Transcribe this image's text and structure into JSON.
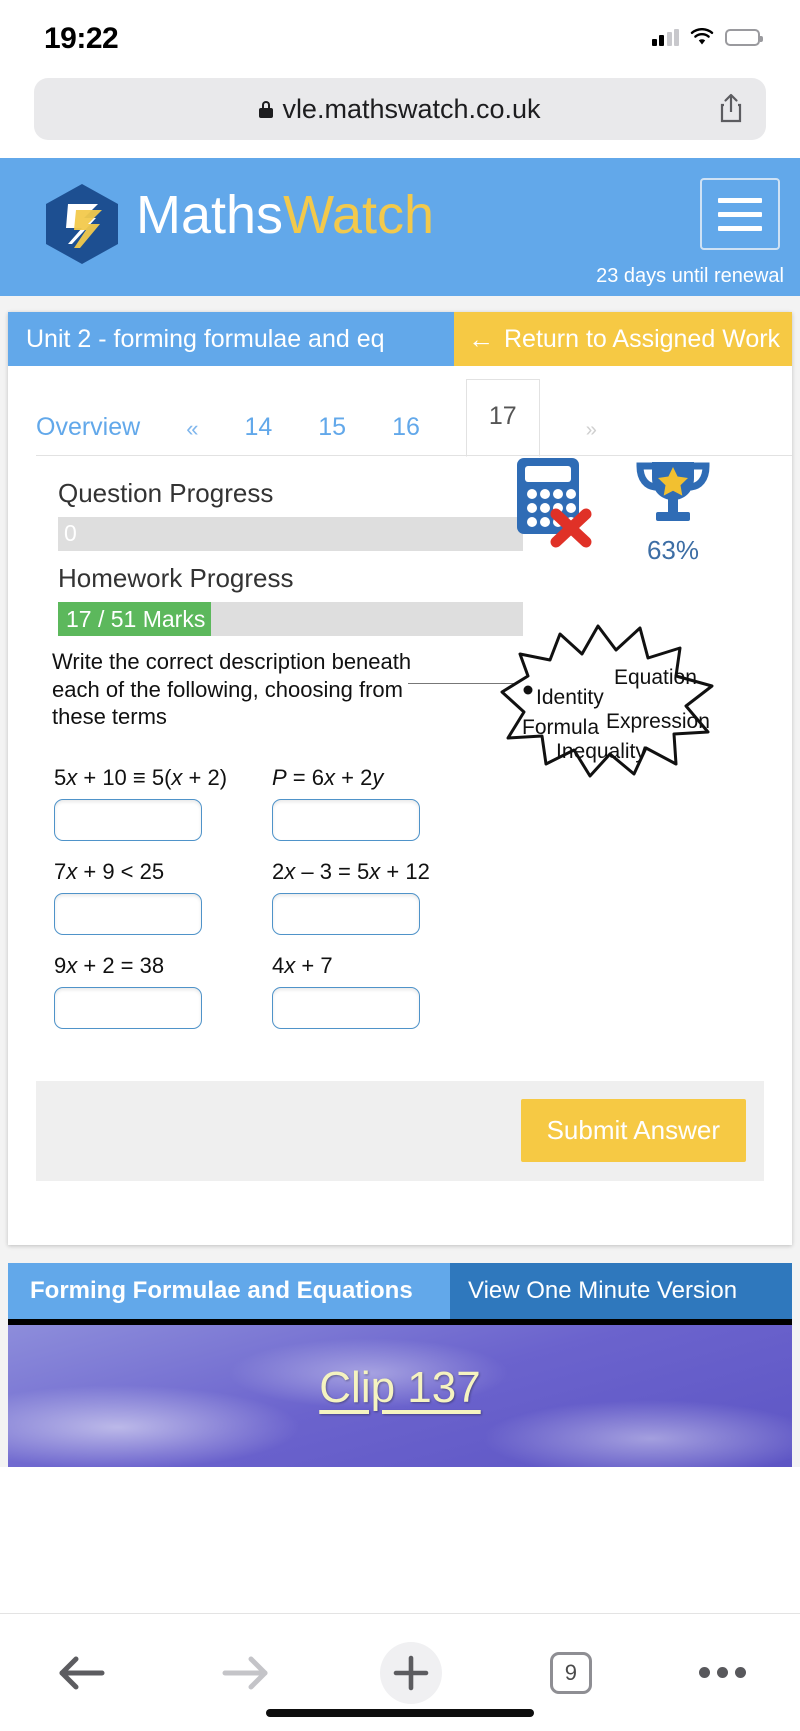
{
  "status_bar": {
    "time": "19:22",
    "signal_icon": "cellular-signal-icon",
    "wifi_icon": "wifi-icon",
    "battery_icon": "battery-icon"
  },
  "browser": {
    "url": "vle.mathswatch.co.uk",
    "lock_icon": "lock-icon",
    "share_icon": "share-icon",
    "back_icon": "arrow-left-icon",
    "forward_icon": "arrow-right-icon",
    "new_tab_icon": "plus-icon",
    "tab_count": "9",
    "more_icon": "ellipsis-icon"
  },
  "site_header": {
    "brand_first": "Maths",
    "brand_second": "Watch",
    "logo_icon": "mathswatch-hexagon-logo",
    "menu_icon": "hamburger-menu-icon",
    "renewal_notice": "23 days until renewal",
    "brand_bg": "#62a8ea",
    "brand_accent": "#f2c94c"
  },
  "panel": {
    "title": "Unit 2 - forming formulae and eq",
    "return_label": "Return to Assigned Work",
    "return_arrow": "←",
    "return_bg": "#f6c944"
  },
  "tabs": {
    "overview": "Overview",
    "prev": "«",
    "next": "»",
    "numbers": [
      "14",
      "15",
      "16",
      "17"
    ],
    "active": "17"
  },
  "progress": {
    "question_label": "Question Progress",
    "question_value": "0",
    "question_percent": 0,
    "homework_label": "Homework Progress",
    "homework_value": "17 / 51 Marks",
    "homework_percent": 33,
    "bar_fill_color": "#5cb85c",
    "bar_track_color": "#dedede"
  },
  "badges": {
    "calculator_icon": "calculator-not-allowed-icon",
    "trophy_icon": "trophy-icon",
    "trophy_percent": "63%",
    "percent_color": "#3d6ea5"
  },
  "question": {
    "instruction": "Write the correct description beneath each of the following, choosing from these terms",
    "terms": [
      "Identity",
      "Equation",
      "Formula",
      "Expression",
      "Inequality"
    ],
    "items": [
      {
        "expr_html": "5<i>x</i> + 10 ≡ 5(<i>x</i> + 2)",
        "answer": ""
      },
      {
        "expr_html": "<i>P</i> = 6<i>x</i> + 2<i>y</i>",
        "answer": ""
      },
      {
        "expr_html": "7<i>x</i> + 9 &lt; 25",
        "answer": ""
      },
      {
        "expr_html": "2<i>x</i> – 3 = 5<i>x</i> + 12",
        "answer": ""
      },
      {
        "expr_html": "9<i>x</i> + 2 = 38",
        "answer": ""
      },
      {
        "expr_html": "4<i>x</i> + 7",
        "answer": ""
      }
    ],
    "submit_label": "Submit Answer"
  },
  "video": {
    "tab_title": "Forming Formulae and Equations",
    "tab_alt": "View One Minute Version",
    "clip_label": "Clip 137"
  }
}
